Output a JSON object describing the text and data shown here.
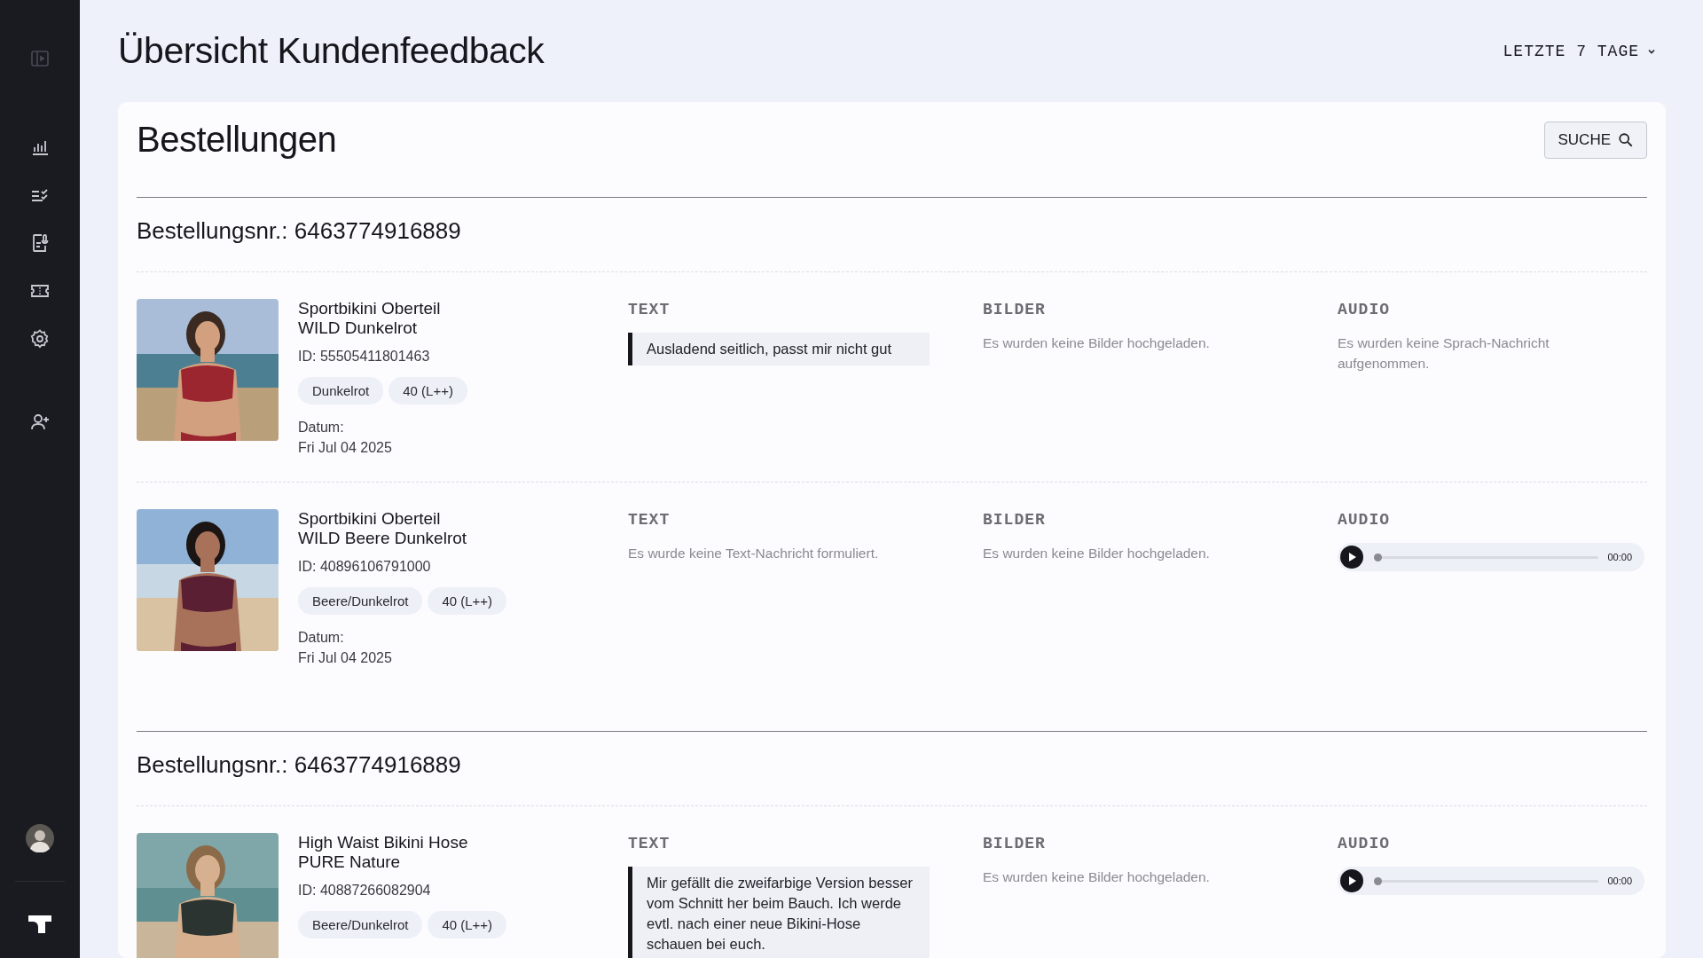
{
  "page": {
    "title": "Übersicht Kundenfeedback",
    "range_filter": "LETZTE 7 TAGE"
  },
  "card": {
    "title": "Bestellungen",
    "search_button": "SUCHE"
  },
  "orders": [
    {
      "heading": "Bestellungsnr.: 6463774916889",
      "items": [
        {
          "photo": {
            "kind": "picture"
          },
          "name_lines": [
            "Sportbikini Oberteil",
            "WILD Dunkelrot"
          ],
          "id": "ID: 55505411801463",
          "tags": [
            "Dunkelrot",
            "40 (L++)"
          ],
          "date_label": "Datum:",
          "date": "Fri Jul 04 2025",
          "columns": [
            {
              "label": "TEXT",
              "kind": "quote",
              "text": "Ausladend seitlich, passt mir nicht gut"
            },
            {
              "label": "BILDER",
              "kind": "empty",
              "text": "Es wurden keine Bilder hochgeladen."
            },
            {
              "label": "AUDIO",
              "kind": "empty",
              "text": "Es wurden keine Sprach-Nachricht aufgenommen."
            }
          ]
        },
        {
          "photo": {
            "kind": "picture"
          },
          "name_lines": [
            "Sportbikini Oberteil",
            "WILD Beere Dunkelrot"
          ],
          "id": "ID: 40896106791000",
          "tags": [
            "Beere/Dunkelrot",
            "40 (L++)"
          ],
          "date_label": "Datum:",
          "date": "Fri Jul 04 2025",
          "columns": [
            {
              "label": "TEXT",
              "kind": "empty",
              "text": "Es wurde keine Text-Nachricht formuliert."
            },
            {
              "label": "BILDER",
              "kind": "empty",
              "text": "Es wurden keine Bilder hochgeladen."
            },
            {
              "label": "AUDIO",
              "kind": "player",
              "level": 0,
              "time": "00:00"
            }
          ]
        }
      ]
    },
    {
      "heading": "Bestellungsnr.: 6463774916889",
      "items": [
        {
          "photo": {
            "kind": "picture"
          },
          "name_lines": [
            "High Waist Bikini Hose",
            "PURE Nature"
          ],
          "id": "ID: 40887266082904",
          "tags": [
            "Beere/Dunkelrot",
            "40 (L++)"
          ],
          "columns": [
            {
              "label": "TEXT",
              "kind": "quote",
              "text": "Mir gefällt die zweifarbige Version besser vom Schnitt her beim Bauch. Ich werde evtl. nach einer neue Bikini-Hose schauen bei euch."
            },
            {
              "label": "BILDER",
              "kind": "empty",
              "text": "Es wurden keine Bilder hochgeladen."
            },
            {
              "label": "AUDIO",
              "kind": "player",
              "level": 0,
              "time": "00:00"
            }
          ]
        }
      ]
    }
  ]
}
